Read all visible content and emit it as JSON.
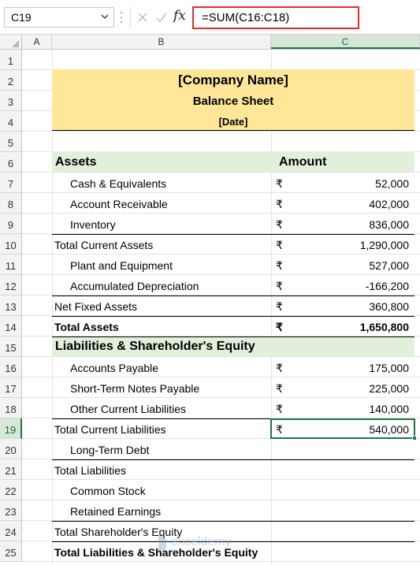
{
  "formula_bar": {
    "name_box": "C19",
    "formula": "=SUM(C16:C18)",
    "fx_label": "fx"
  },
  "columns": [
    "A",
    "B",
    "C"
  ],
  "rows": [
    "1",
    "2",
    "3",
    "4",
    "5",
    "6",
    "7",
    "8",
    "9",
    "10",
    "11",
    "12",
    "13",
    "14",
    "15",
    "16",
    "17",
    "18",
    "19",
    "20",
    "21",
    "22",
    "23",
    "24",
    "25"
  ],
  "sheet": {
    "company_name": "[Company Name]",
    "title": "Balance Sheet",
    "date": "[Date]",
    "assets_header": "Assets",
    "amount_header": "Amount",
    "currency_symbol": "₹",
    "items": {
      "cash": {
        "label": "Cash & Equivalents",
        "value": "52,000"
      },
      "ar": {
        "label": "Account Receivable",
        "value": "402,000"
      },
      "inventory": {
        "label": "Inventory",
        "value": "836,000"
      },
      "tca": {
        "label": "Total Current Assets",
        "value": "1,290,000"
      },
      "ppe": {
        "label": "Plant and Equipment",
        "value": "527,000"
      },
      "accdep": {
        "label": "Accumulated Depreciation",
        "value": "-166,200"
      },
      "nfa": {
        "label": "Net Fixed Assets",
        "value": "360,800"
      },
      "ta": {
        "label": "Total Assets",
        "value": "1,650,800"
      },
      "ap": {
        "label": "Accounts Payable",
        "value": "175,000"
      },
      "stnp": {
        "label": "Short-Term Notes Payable",
        "value": "225,000"
      },
      "ocl": {
        "label": "Other Current Liabilities",
        "value": "140,000"
      },
      "tcl": {
        "label": "Total Current Liabilities",
        "value": "540,000"
      },
      "ltd": {
        "label": "Long-Term Debt"
      },
      "tl": {
        "label": "Total Liabilities"
      },
      "cs": {
        "label": "Common Stock"
      },
      "re": {
        "label": "Retained Earnings"
      },
      "tse": {
        "label": "Total Shareholder's Equity"
      },
      "tlse": {
        "label": "Total Liabilities & Shareholder's Equity"
      }
    },
    "liab_header": "Liabilities & Shareholder's Equity"
  },
  "watermark": {
    "name": "exceldemy",
    "tagline": "EXCEL · DATA · BI"
  },
  "colors": {
    "header_band": "#ffe699",
    "section_band": "#e2efda",
    "selection": "#217346",
    "formula_border": "#d9302c"
  }
}
